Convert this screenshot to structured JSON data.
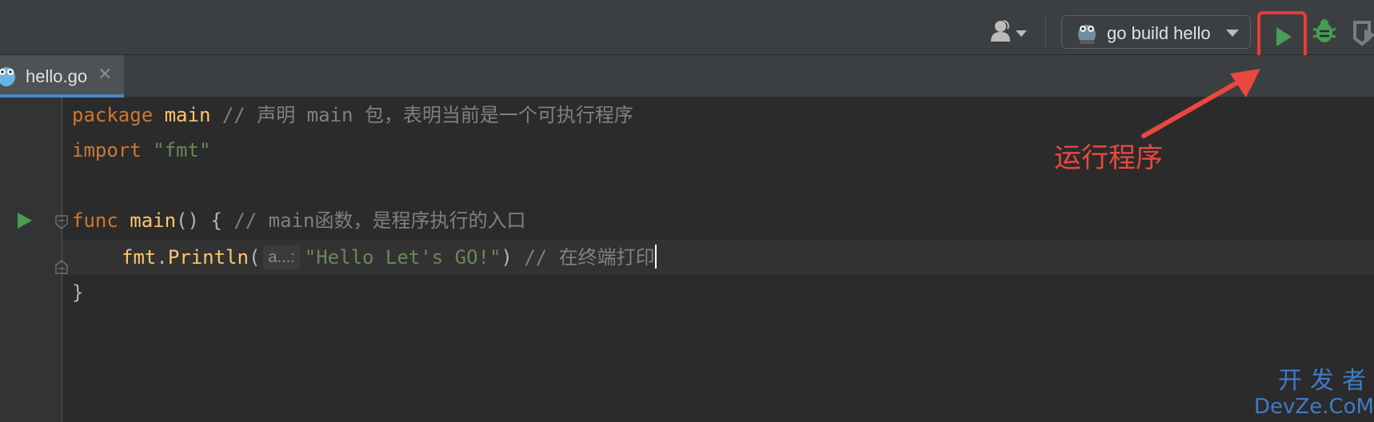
{
  "toolbar": {
    "run_config_label": "go build hello",
    "icons": {
      "user": "user-icon",
      "gopher": "gopher-icon",
      "run": "run-icon",
      "debug": "debug-icon",
      "coverage": "coverage-icon"
    }
  },
  "tabs": [
    {
      "label": "hello.go",
      "close_glyph": "✕",
      "icon": "gopher-icon",
      "active": true
    }
  ],
  "editor": {
    "lines": [
      {
        "keyword": "package",
        "name": "main",
        "comment": "// 声明 main 包，表明当前是一个可执行程序"
      },
      {
        "keyword": "import",
        "string": "\"fmt\""
      },
      {},
      {
        "keyword": "func",
        "name": "main",
        "punct": "() {",
        "comment": "// main函数，是程序执行的入口"
      },
      {
        "object": "fmt",
        "dot": ".",
        "method": "Println",
        "open": "(",
        "hint": "a...:",
        "string": "\"Hello Let's GO!\"",
        "close": ")",
        "comment": "// 在终端打印"
      },
      {
        "punct": "}"
      }
    ]
  },
  "annotation": {
    "text": "运行程序",
    "color": "#e9483f"
  },
  "watermark": {
    "cn": "开发者",
    "en": "DevZe.CoM"
  },
  "colors": {
    "keyword": "#cc7832",
    "function": "#ffc66d",
    "string": "#6a8759",
    "comment": "#808080",
    "run_green": "#499c54",
    "highlight_red": "#e83b3a",
    "tab_underline": "#4a88c7"
  }
}
